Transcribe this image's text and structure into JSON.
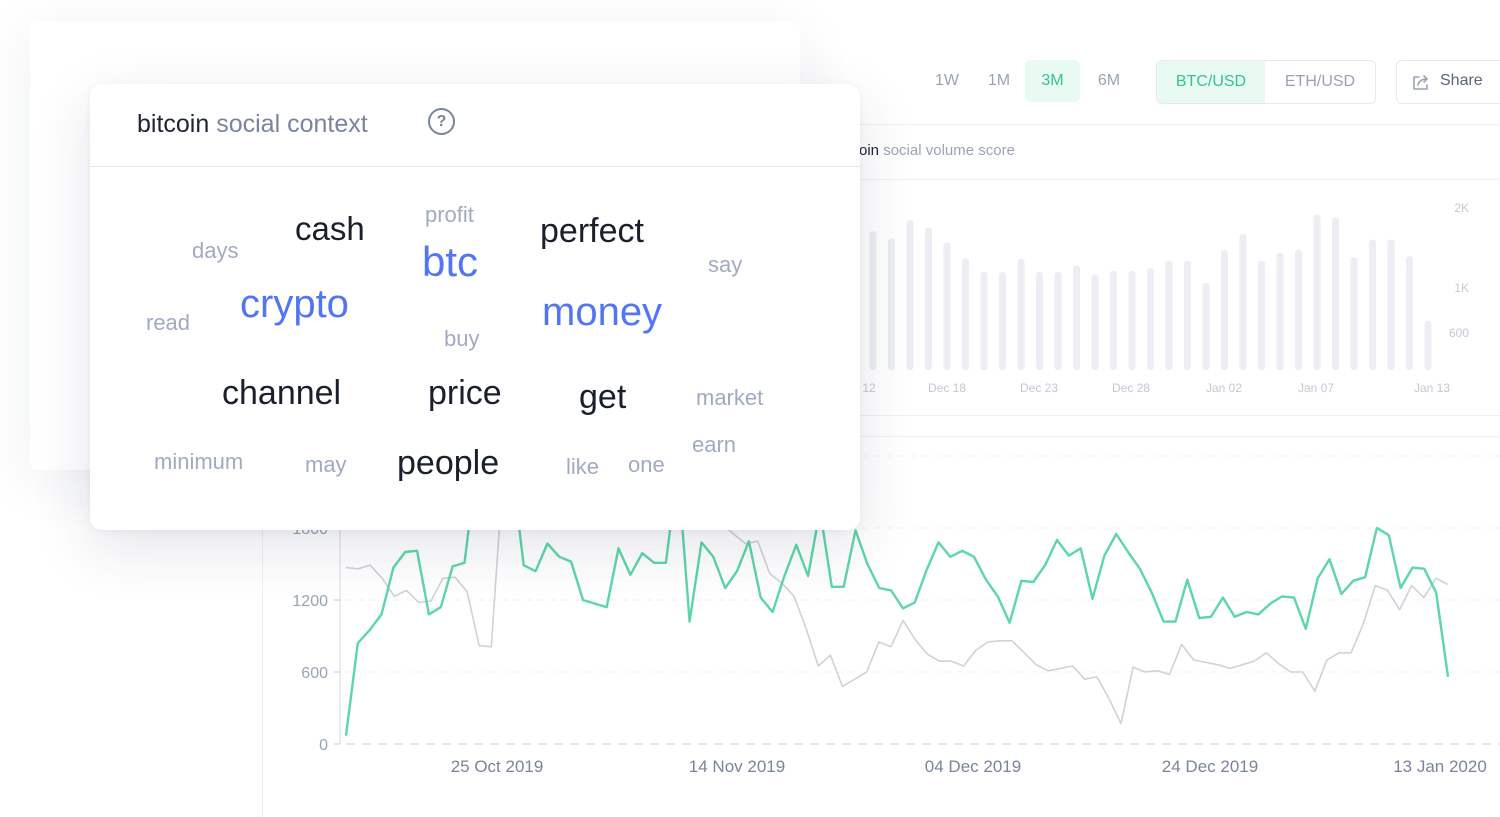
{
  "toolbar": {
    "ranges": [
      "1W",
      "1M",
      "3M",
      "6M"
    ],
    "active_range": "3M",
    "pairs": [
      "BTC/USD",
      "ETH/USD"
    ],
    "active_pair": "BTC/USD",
    "share_label": "Share"
  },
  "volume_panel": {
    "title_coin": "oin",
    "title_rest": "social volume score"
  },
  "popover": {
    "title_coin": "bitcoin",
    "title_rest": "social context",
    "help_icon": "question-circle-icon",
    "words": [
      {
        "text": "cash",
        "weight": "dark"
      },
      {
        "text": "profit",
        "weight": "muted"
      },
      {
        "text": "perfect",
        "weight": "dark"
      },
      {
        "text": "days",
        "weight": "muted"
      },
      {
        "text": "btc",
        "weight": "blue"
      },
      {
        "text": "say",
        "weight": "muted"
      },
      {
        "text": "crypto",
        "weight": "blue"
      },
      {
        "text": "money",
        "weight": "blue"
      },
      {
        "text": "read",
        "weight": "muted"
      },
      {
        "text": "buy",
        "weight": "muted"
      },
      {
        "text": "channel",
        "weight": "dark"
      },
      {
        "text": "price",
        "weight": "dark"
      },
      {
        "text": "get",
        "weight": "dark"
      },
      {
        "text": "market",
        "weight": "muted"
      },
      {
        "text": "earn",
        "weight": "muted"
      },
      {
        "text": "minimum",
        "weight": "muted"
      },
      {
        "text": "may",
        "weight": "muted"
      },
      {
        "text": "people",
        "weight": "dark"
      },
      {
        "text": "like",
        "weight": "muted"
      },
      {
        "text": "one",
        "weight": "muted"
      }
    ]
  },
  "colors": {
    "accent_green": "#5dd6a8",
    "accent_blue": "#5275f5",
    "price_gray": "#cfd2d8",
    "bar_gray": "#eceef3"
  },
  "chart_data": [
    {
      "type": "bar",
      "title": "social volume score",
      "x_tick_labels": [
        "12",
        "Dec 18",
        "Dec 23",
        "Dec 28",
        "Jan 02",
        "Jan 07",
        "Jan 13"
      ],
      "y_tick_labels": [
        "2K",
        "1K",
        "600"
      ],
      "values": [
        1500,
        1420,
        1620,
        1540,
        1380,
        1210,
        1060,
        1060,
        1200,
        1060,
        1060,
        1130,
        1030,
        1070,
        1070,
        1100,
        1180,
        1180,
        940,
        1300,
        1470,
        1180,
        1270,
        1300,
        1680,
        1650,
        1220,
        1410,
        1410,
        1230,
        530
      ],
      "ylim": [
        0,
        2000
      ],
      "grid": false
    },
    {
      "type": "line",
      "x_tick_labels": [
        "25 Oct 2019",
        "14 Nov 2019",
        "04 Dec 2019",
        "24 Dec 2019",
        "13 Jan 2020"
      ],
      "y_tick_labels": [
        "0",
        "600",
        "1200",
        "1800"
      ],
      "ylim": [
        0,
        2000
      ],
      "grid": true,
      "series": [
        {
          "color": "#5dd6a8",
          "values": [
            70,
            840,
            950,
            1080,
            1470,
            1600,
            1610,
            1080,
            1140,
            1480,
            1510,
            2300,
            2300,
            2300,
            2300,
            1490,
            1440,
            1670,
            1560,
            1520,
            1200,
            1170,
            1140,
            1630,
            1410,
            1590,
            1510,
            1510,
            2300,
            1020,
            1680,
            1560,
            1300,
            1440,
            1690,
            1220,
            1100,
            1400,
            1660,
            1400,
            1950,
            1310,
            1310,
            1780,
            1500,
            1300,
            1280,
            1130,
            1180,
            1450,
            1680,
            1560,
            1610,
            1560,
            1370,
            1230,
            1010,
            1360,
            1350,
            1490,
            1700,
            1570,
            1630,
            1210,
            1570,
            1750,
            1600,
            1460,
            1260,
            1020,
            1020,
            1370,
            1050,
            1060,
            1220,
            1060,
            1100,
            1080,
            1170,
            1230,
            1220,
            960,
            1380,
            1540,
            1250,
            1360,
            1390,
            1800,
            1740,
            1300,
            1470,
            1460,
            1260,
            560
          ]
        },
        {
          "color": "#cfd2d8",
          "values": [
            1470,
            1460,
            1490,
            1380,
            1230,
            1280,
            1180,
            1190,
            1380,
            1390,
            1270,
            820,
            810,
            2300,
            2300,
            2300,
            2300,
            2300,
            2300,
            2300,
            2300,
            2300,
            2300,
            2300,
            2300,
            2300,
            2300,
            2300,
            2300,
            2300,
            1810,
            1840,
            1750,
            1670,
            1690,
            1420,
            1340,
            1230,
            960,
            650,
            740,
            480,
            540,
            600,
            850,
            810,
            1030,
            870,
            750,
            690,
            690,
            650,
            780,
            850,
            860,
            860,
            760,
            660,
            610,
            630,
            650,
            540,
            560,
            380,
            170,
            640,
            600,
            610,
            580,
            830,
            700,
            680,
            660,
            630,
            660,
            690,
            760,
            670,
            600,
            600,
            440,
            700,
            760,
            760,
            1000,
            1320,
            1280,
            1120,
            1320,
            1220,
            1380,
            1330
          ]
        }
      ]
    }
  ]
}
